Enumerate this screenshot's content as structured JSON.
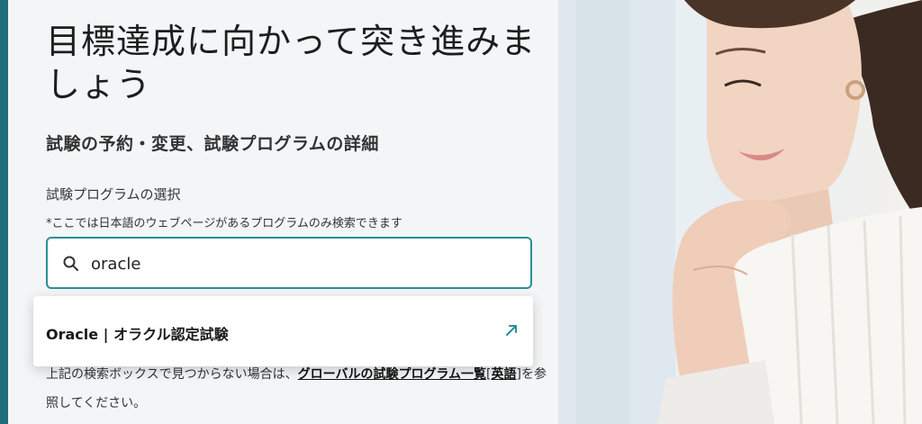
{
  "hero": {
    "headline": "目標達成に向かって突き進みましょう",
    "subtitle": "試験の予約・変更、試験プログラムの詳細"
  },
  "search": {
    "label": "試験プログラムの選択",
    "note": "*ここでは日本語のウェブページがあるプログラムのみ検索できます",
    "value": "oracle",
    "icon": "search-icon"
  },
  "results": [
    {
      "label": "Oracle | オラクル認定試験",
      "icon": "external-arrow-icon"
    }
  ],
  "help": {
    "prefix": "上記の検索ボックスで見つからない場合は、",
    "link1": "グローバルの試験プログラム一覧",
    "link2": "英語",
    "suffix": "を参照してください。"
  },
  "colors": {
    "accent": "#2b8f97",
    "left_bar": "#1f6d7a"
  }
}
